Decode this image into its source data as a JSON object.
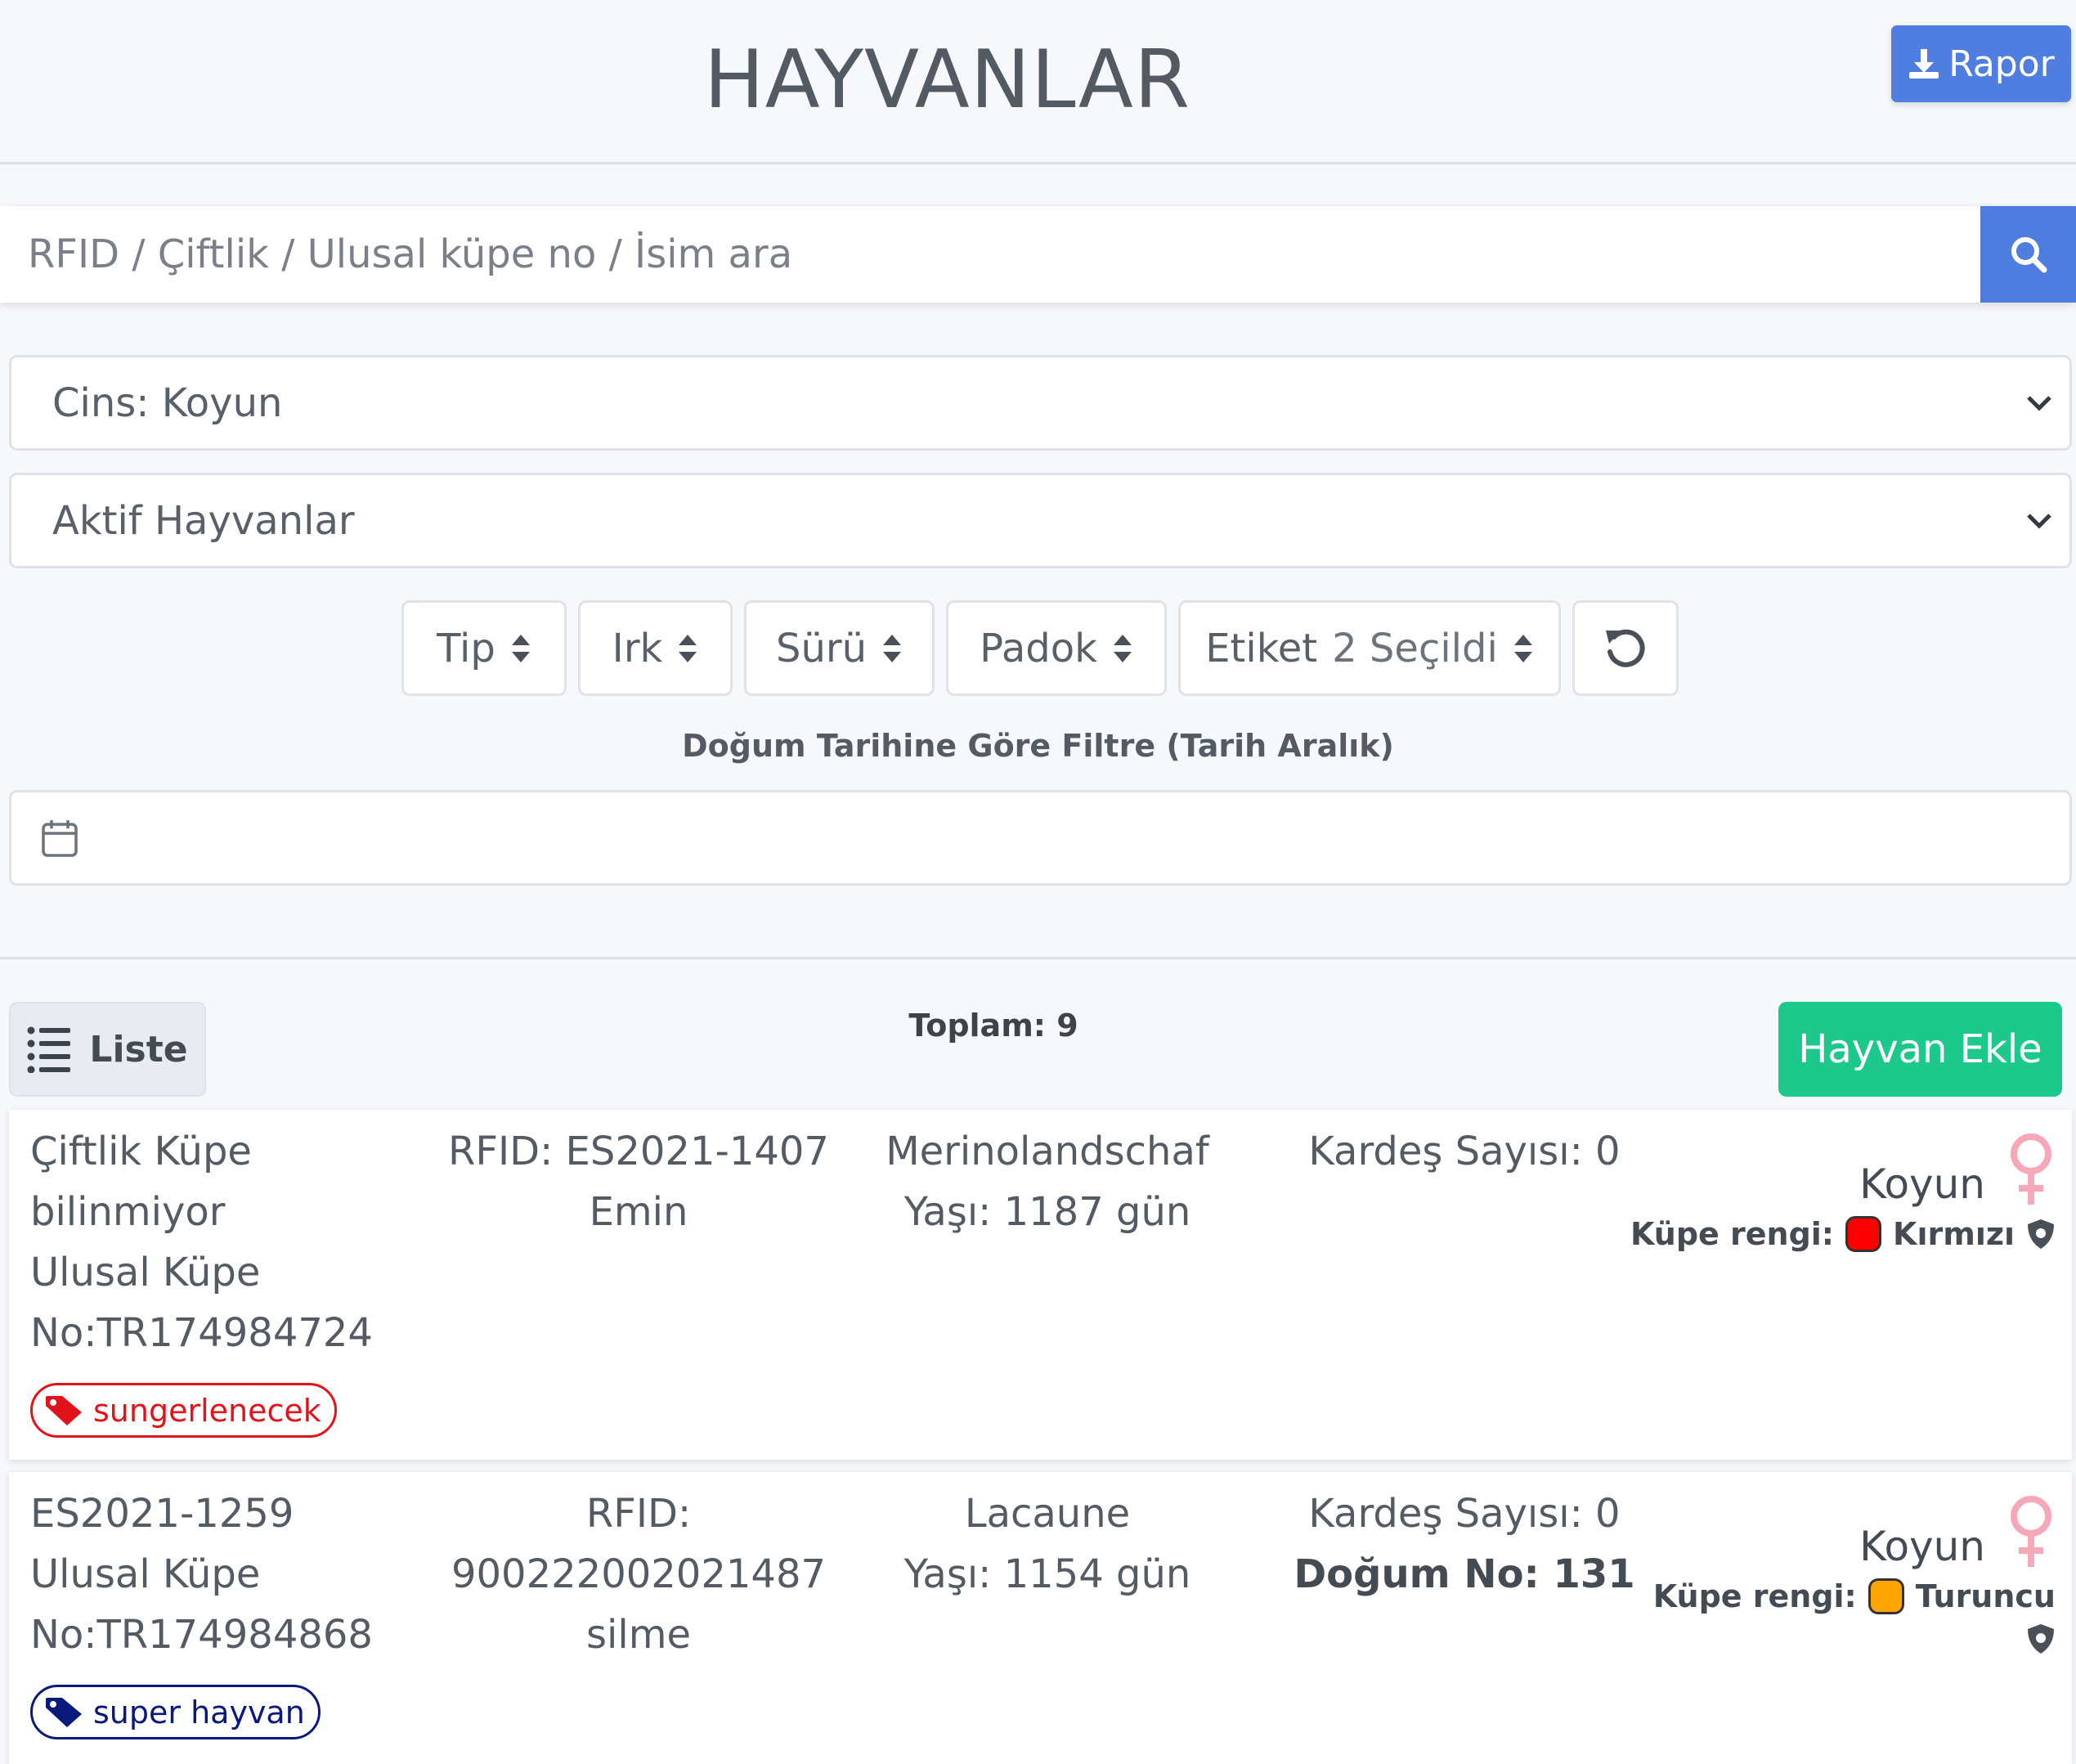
{
  "header": {
    "title": "HAYVANLAR",
    "rapor_label": "Rapor"
  },
  "search": {
    "placeholder": "RFID / Çiftlik / Ulusal küpe no / İsim ara"
  },
  "selects": {
    "species": "Cins: Koyun",
    "status": "Aktif Hayvanlar"
  },
  "filters": {
    "tip": "Tip",
    "irk": "Irk",
    "suru": "Sürü",
    "padok": "Padok",
    "etiket": "Etiket",
    "etiket_selected": "2 Seçildi"
  },
  "date_filter": {
    "label": "Doğum Tarihine Göre Filtre (Tarih Aralık)"
  },
  "list": {
    "view_label": "Liste",
    "total": "Toplam: 9",
    "add_label": "Hayvan Ekle"
  },
  "colors": {
    "primary": "#4f7ee0",
    "success": "#1cc88a",
    "female": "#f7a8b8"
  },
  "animals": [
    {
      "farm_line1": "Çiftlik Küpe",
      "farm_line2": "bilinmiyor",
      "national_line1": "Ulusal Küpe",
      "national_line2": "No:TR174984724",
      "tag": "sungerlenecek",
      "tag_color": "#e3131b",
      "rfid_line1": "RFID: ES2021-1407",
      "rfid_line2": "Emin",
      "breed": "Merinolandschaf",
      "age": "Yaşı: 1187 gün",
      "siblings": "Kardeş Sayısı: 0",
      "birth_no": "",
      "species": "Koyun",
      "ear_label": "Küpe rengi:",
      "ear_color_name": "Kırmızı",
      "ear_color": "#ff0000"
    },
    {
      "farm_line1": "ES2021-1259",
      "national_line1": "Ulusal Küpe",
      "national_line2": "No:TR174984868",
      "tag": "super hayvan",
      "tag_color": "#0a1a7a",
      "rfid_line1": "RFID:",
      "rfid_line2": "900222002021487",
      "rfid_line3": "silme",
      "breed": "Lacaune",
      "age": "Yaşı: 1154 gün",
      "siblings": "Kardeş Sayısı: 0",
      "birth_no": "Doğum No: 131",
      "species": "Koyun",
      "ear_label": "Küpe rengi:",
      "ear_color_name": "Turuncu",
      "ear_color": "#ffa500"
    }
  ]
}
